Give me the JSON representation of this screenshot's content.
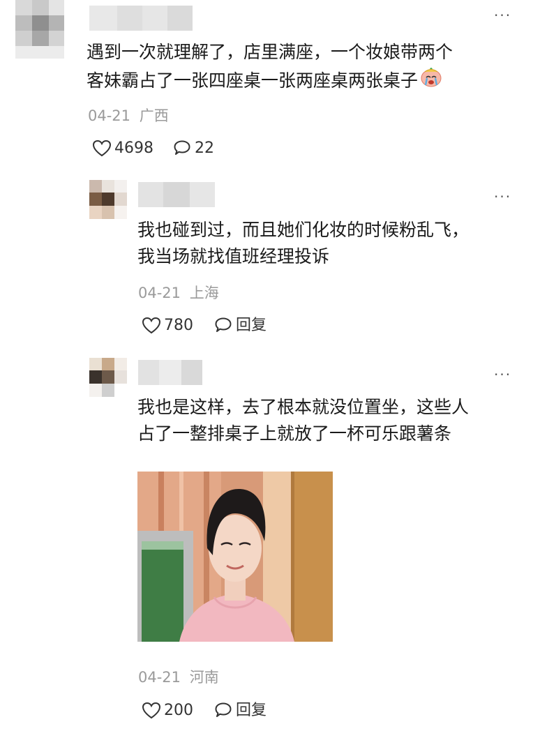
{
  "comments": [
    {
      "text_line1": "遇到一次就理解了，店里满座，一个妆娘带两个",
      "text_line2": "客妹霸占了一张四座桌一张两座桌两张桌子",
      "emoji": "crying-face-emoji",
      "date": "04-21",
      "location": "广西",
      "likes": "4698",
      "replies": "22",
      "more": "···"
    },
    {
      "text_line1": "我也碰到过，而且她们化妆的时候粉乱飞，",
      "text_line2": "我当场就找值班经理投诉",
      "date": "04-21",
      "location": "上海",
      "likes": "780",
      "reply_label": "回复",
      "more": "···"
    },
    {
      "text_line1": "我也是这样，去了根本就没位置坐，这些人",
      "text_line2": "占了一整排桌子上就放了一杯可乐跟薯条",
      "image": "photo-smiling-woman-short-hair-pink-top",
      "date": "04-21",
      "location": "河南",
      "likes": "200",
      "reply_label": "回复",
      "more": "···"
    }
  ],
  "colors": {
    "text": "#1a1a1a",
    "meta": "#9a9a9a",
    "icon": "#333333"
  },
  "icons": {
    "like": "heart-outline-icon",
    "comment": "speech-bubble-icon",
    "more": "more-dots-icon"
  }
}
